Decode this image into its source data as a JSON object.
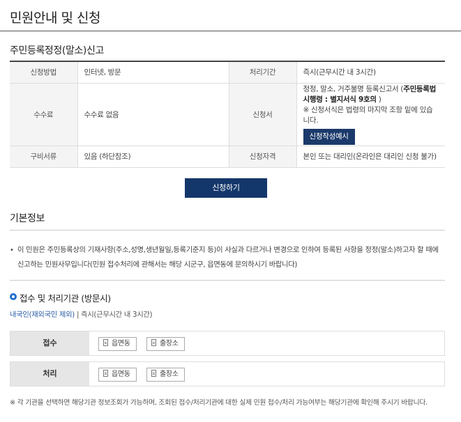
{
  "page": {
    "title": "민원안내 및 신청"
  },
  "section": {
    "title": "주민등록정정(말소)신고"
  },
  "info": {
    "method_label": "신청방법",
    "method_value": "인터넷, 방문",
    "period_label": "처리기간",
    "period_value": "즉시(근무시간 내 3시간)",
    "fee_label": "수수료",
    "fee_value": "수수료 없음",
    "form_label": "신청서",
    "form_text1": "정정, 말소, 거주불명 등록신고서 (",
    "form_text_bold": "주민등록법 시행령 : 별지서식 9호의",
    "form_text2": " )",
    "form_note": "※ 신청서식은 법령의 마지막 조항 밑에 있습니다.",
    "form_button": "신청작성예시",
    "docs_label": "구비서류",
    "docs_value": "있음 (하단참조)",
    "qual_label": "신청자격",
    "qual_value": "본인 또는 대리인(온라인은 대리인 신청 불가)"
  },
  "apply_button": "신청하기",
  "basic": {
    "title": "기본정보",
    "bullet": "•",
    "text": "이 민원은 주민등록상의 기재사항(주소,성명,생년월일,등록기준지 등)이 사실과 다르거나 변경으로 인하여 등록된 사항을 정정(말소)하고자 할 때에 신고하는 민원사무입니다(민원 접수처리에 관해서는 해당 시군구, 읍면동에 문의하시기 바랍니다)"
  },
  "agency": {
    "title": "접수 및 처리기관 (방문시)",
    "sub_link": "내국인(재외국민 제외)",
    "sub_rest": " | 즉시(근무시간 내 3시간)",
    "receive_label": "접수",
    "process_label": "처리",
    "chip1": "읍면동",
    "chip2": "출장소"
  },
  "footnote": "※ 각 기관을 선택하면 해당기관 정보조회가 가능하며, 조회된 접수/처리기관에 대한 실제 민원 접수/처리 가능여부는 해당기관에 확인해 주시기 바랍니다."
}
